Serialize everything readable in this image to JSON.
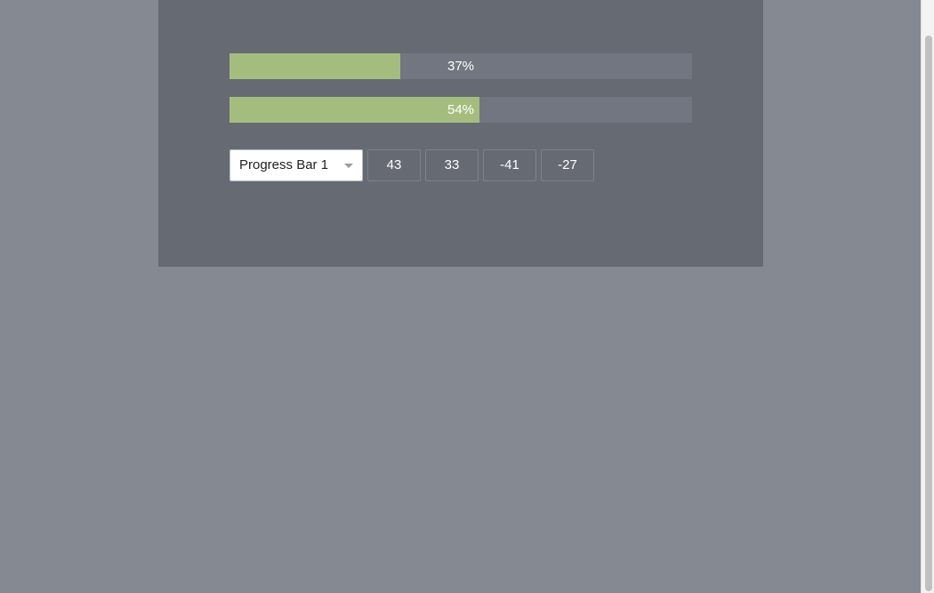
{
  "progress_bars": [
    {
      "label": "37%",
      "value": 0.37,
      "fill_color": "#a4bd7f"
    },
    {
      "label": "54%",
      "value": 0.54,
      "fill_color": "#a4bd7f"
    }
  ],
  "controls": {
    "selected_bar": "Progress Bar 1",
    "buttons": [
      "43",
      "33",
      "-41",
      "-27"
    ]
  },
  "colors": {
    "page_background": "#858992",
    "panel_background": "#666a73",
    "track": "#727680",
    "fill": "#a4bd7f"
  }
}
